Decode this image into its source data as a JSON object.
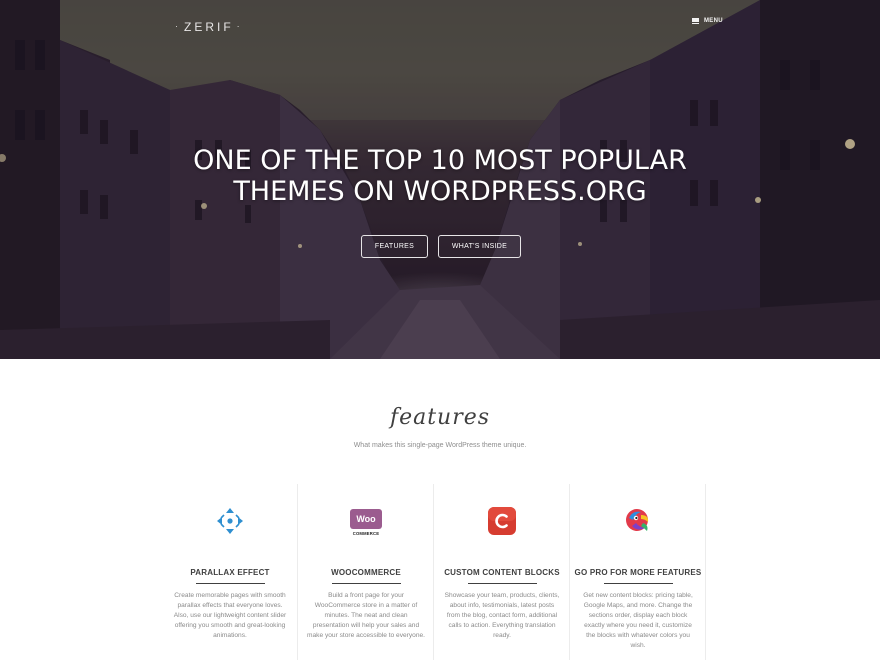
{
  "header": {
    "logo": "ZERIF",
    "menu_label": "MENU"
  },
  "hero": {
    "title_line1": "ONE OF THE TOP 10 MOST POPULAR",
    "title_line2": "THEMES ON WORDPRESS.ORG",
    "buttons": [
      {
        "label": "FEATURES"
      },
      {
        "label": "WHAT'S INSIDE"
      }
    ]
  },
  "features": {
    "title": "features",
    "subtitle": "What makes this single-page WordPress theme unique.",
    "items": [
      {
        "icon": "parallax-arrows-icon",
        "title": "PARALLAX EFFECT",
        "text": "Create memorable pages with smooth parallax effects that everyone loves. Also, use our lightweight content slider offering you smooth and great-looking animations."
      },
      {
        "icon": "woocommerce-logo-icon",
        "icon_text": "Woo",
        "icon_subtext": "COMMERCE",
        "title": "WOOCOMMERCE",
        "text": "Build a front page for your WooCommerce store in a matter of minutes. The neat and clean presentation will help your sales and make your store accessible to everyone."
      },
      {
        "icon": "content-blocks-c-icon",
        "title": "CUSTOM CONTENT BLOCKS",
        "text": "Showcase your team, products, clients, about info, testimonials, latest posts from the blog, contact form, additional calls to action. Everything translation ready."
      },
      {
        "icon": "go-pro-parrot-icon",
        "title": "GO PRO FOR MORE FEATURES",
        "text": "Get new content blocks: pricing table, Google Maps, and more. Change the sections order, display each block exactly where you need it, customize the blocks with whatever colors you wish."
      }
    ]
  },
  "colors": {
    "parallax_blue": "#2f8fd0",
    "woo_purple": "#9b5c8f",
    "content_red": "#d63c30"
  }
}
